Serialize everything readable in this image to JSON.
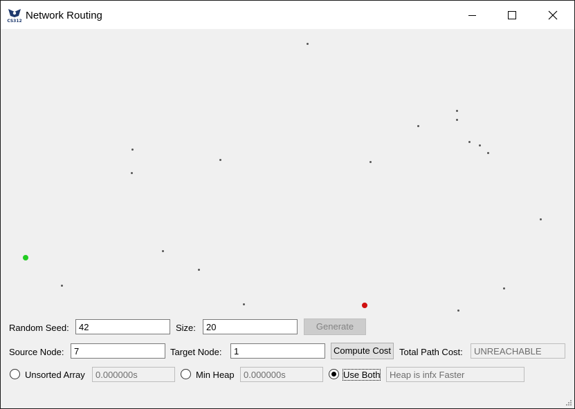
{
  "window": {
    "title": "Network Routing",
    "icon": "cs312-logo-icon"
  },
  "controls": {
    "random_seed_label": "Random Seed:",
    "random_seed_value": "42",
    "size_label": "Size:",
    "size_value": "20",
    "generate_label": "Generate",
    "source_label": "Source Node:",
    "source_value": "7",
    "target_label": "Target Node:",
    "target_value": "1",
    "compute_label": "Compute Cost",
    "total_cost_label": "Total Path Cost:",
    "total_cost_value": "UNREACHABLE",
    "unsorted_label": "Unsorted Array",
    "unsorted_time": "0.000000s",
    "minheap_label": "Min Heap",
    "minheap_time": "0.000000s",
    "both_label": "Use Both",
    "comparison_text": "Heap is infx Faster",
    "selected_mode": "Use Both"
  },
  "colors": {
    "source_node": "#22cc22",
    "target_node": "#d01010"
  }
}
